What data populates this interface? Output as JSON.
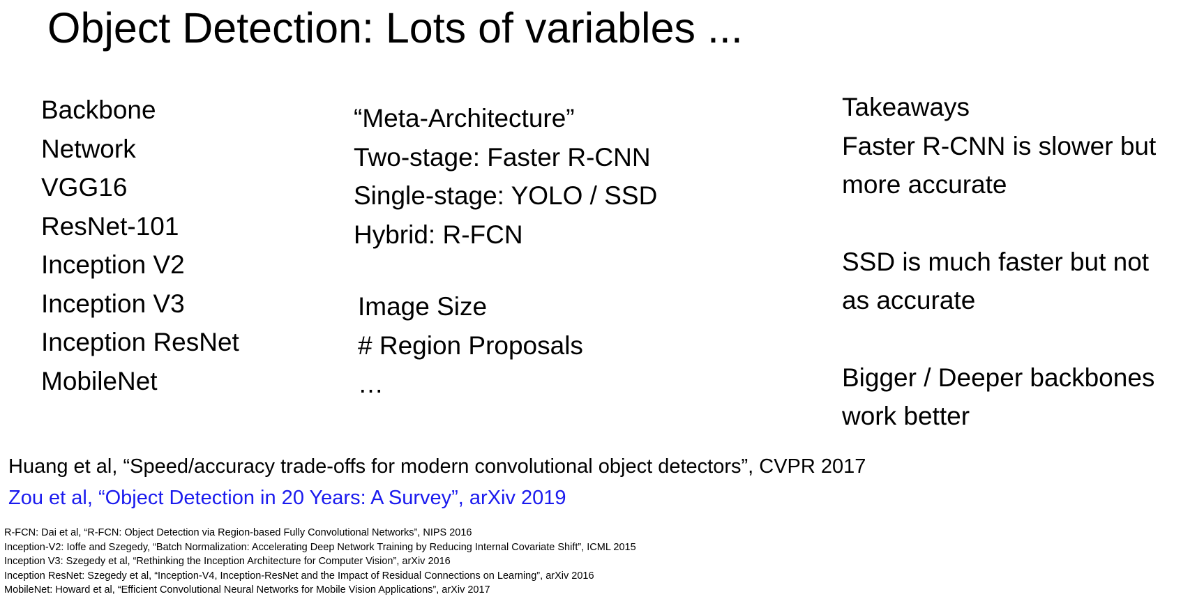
{
  "slide": {
    "title": "Object Detection: Lots of variables ..."
  },
  "backbone": {
    "items": [
      "Backbone",
      "Network",
      "VGG16",
      "ResNet-101",
      "Inception V2",
      "Inception V3",
      "Inception ResNet",
      "MobileNet"
    ]
  },
  "meta_architecture": {
    "items": [
      "“Meta-Architecture”",
      "Two-stage: Faster R-CNN",
      "Single-stage: YOLO / SSD",
      "Hybrid: R-FCN"
    ]
  },
  "other_variables": {
    "items": [
      "Image Size",
      "# Region Proposals",
      "…"
    ]
  },
  "takeaways": {
    "heading": "Takeaways",
    "point1_line1": "Faster R-CNN is slower but",
    "point1_line2": "more accurate",
    "point2_line1": "SSD is much faster but not",
    "point2_line2": "as accurate",
    "point3_line1": "Bigger / Deeper backbones",
    "point3_line2": "work better"
  },
  "references": {
    "main": "Huang et al, “Speed/accuracy trade-offs for modern convolutional object detectors”, CVPR 2017",
    "survey_link": "Zou et al, “Object Detection in 20 Years: A Survey”, arXiv 2019",
    "footnotes": [
      "R-FCN: Dai et al, “R-FCN: Object Detection via Region-based Fully Convolutional Networks”, NIPS 2016",
      "Inception-V2: Ioffe and Szegedy, “Batch Normalization: Accelerating Deep Network Training by Reducing Internal Covariate Shift”, ICML 2015",
      "Inception V3: Szegedy et al, “Rethinking the Inception Architecture for Computer Vision”, arXiv 2016",
      "Inception ResNet: Szegedy et al, “Inception-V4, Inception-ResNet and the Impact of Residual Connections on Learning”, arXiv 2016",
      "MobileNet: Howard et al, “Efficient Convolutional Neural Networks for Mobile Vision Applications”, arXiv 2017"
    ]
  },
  "colors": {
    "link": "#1a1aee",
    "text": "#000000",
    "background": "#ffffff"
  }
}
